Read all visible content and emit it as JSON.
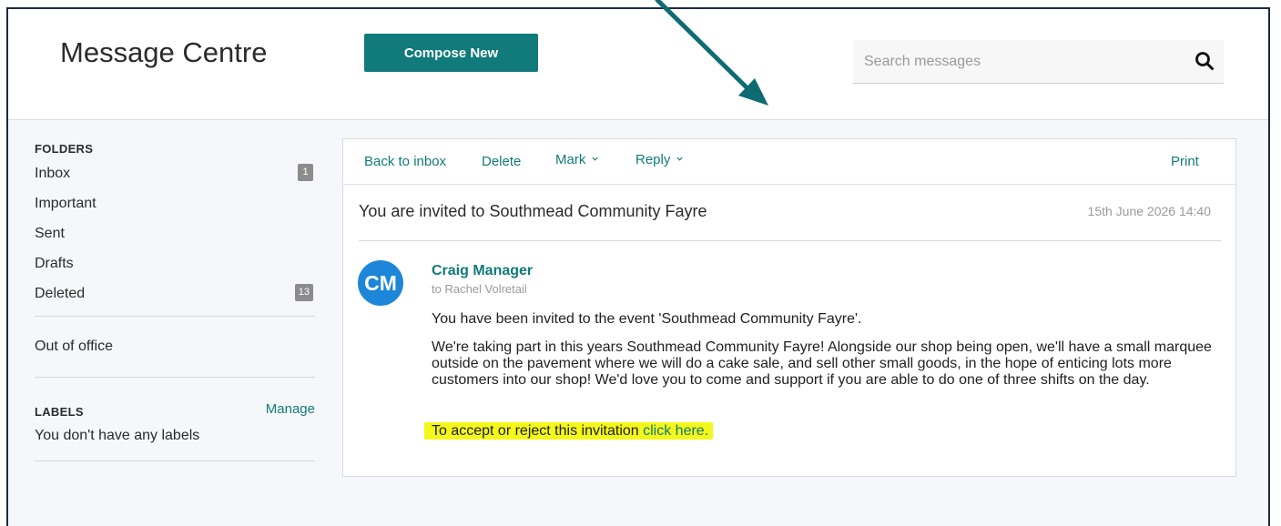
{
  "header": {
    "title": "Message Centre",
    "compose_label": "Compose New",
    "search_placeholder": "Search messages",
    "search_icon": "search-icon"
  },
  "sidebar": {
    "folders_heading": "FOLDERS",
    "folders": [
      {
        "label": "Inbox",
        "badge": "1"
      },
      {
        "label": "Important",
        "badge": null
      },
      {
        "label": "Sent",
        "badge": null
      },
      {
        "label": "Drafts",
        "badge": null
      },
      {
        "label": "Deleted",
        "badge": "13"
      }
    ],
    "out_of_office": "Out of office",
    "labels_heading": "LABELS",
    "manage_label": "Manage",
    "no_labels": "You don't have any labels"
  },
  "toolbar": {
    "back": "Back to inbox",
    "delete": "Delete",
    "mark": "Mark",
    "reply": "Reply",
    "print": "Print"
  },
  "message": {
    "subject": "You are invited to Southmead Community Fayre",
    "date": "15th June 2026 14:40",
    "avatar_initials": "CM",
    "sender": "Craig Manager",
    "recipient": "to Rachel Volretail",
    "paragraph1": "You have been invited to the event 'Southmead Community Fayre'.",
    "paragraph2": "We're taking part in this years Southmead Community Fayre! Alongside our shop being open, we'll have a small marquee outside on the pavement where we will do a cake sale, and sell other small goods, in the hope of enticing lots more customers into our shop! We'd love you to come and support if you are able to do one of three shifts on the day.",
    "invite_text": "To accept or reject this invitation ",
    "invite_link": "click here."
  },
  "colors": {
    "accent": "#117a7a",
    "avatar": "#1d86d8",
    "highlight": "#f4f71a",
    "badge": "#8c8c8c",
    "annotation_arrow": "#0e6b72"
  }
}
